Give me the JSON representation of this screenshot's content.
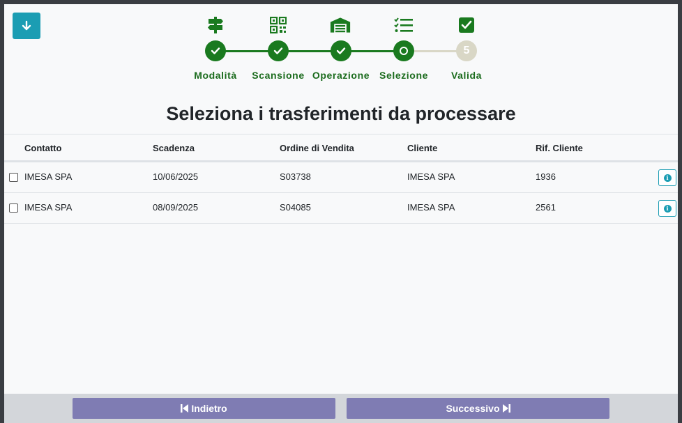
{
  "stepper": {
    "steps": [
      {
        "label": "Modalità",
        "state": "done",
        "icon": "signpost-icon"
      },
      {
        "label": "Scansione",
        "state": "done",
        "icon": "qr-code-icon"
      },
      {
        "label": "Operazione",
        "state": "done",
        "icon": "warehouse-icon"
      },
      {
        "label": "Selezione",
        "state": "current",
        "icon": "checklist-icon"
      },
      {
        "label": "Valida",
        "state": "todo",
        "icon": "check-square-icon",
        "number": "5"
      }
    ],
    "colors": {
      "done": "#1a7a1f",
      "todo": "#d9d7c6"
    }
  },
  "title": "Seleziona i trasferimenti da processare",
  "table": {
    "columns": [
      "Contatto",
      "Scadenza",
      "Ordine di Vendita",
      "Cliente",
      "Rif. Cliente"
    ],
    "rows": [
      [
        "IMESA SPA",
        "10/06/2025",
        "S03738",
        "IMESA SPA",
        "1936"
      ],
      [
        "IMESA SPA",
        "08/09/2025",
        "S04085",
        "IMESA SPA",
        "2561"
      ]
    ]
  },
  "footer": {
    "back_label": "Indietro",
    "next_label": "Successivo"
  },
  "colors": {
    "accent": "#1b9db3",
    "footer_button": "#7f7cb3"
  }
}
